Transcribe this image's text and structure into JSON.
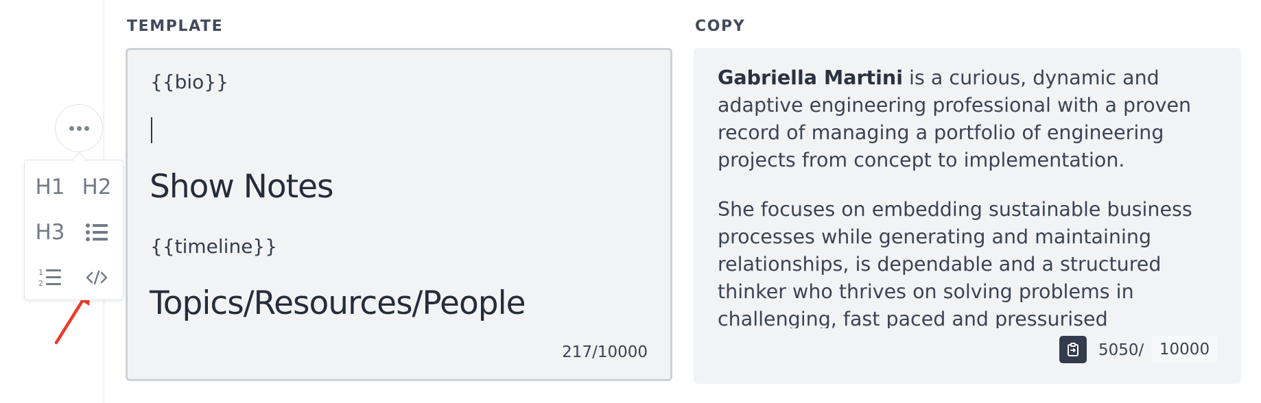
{
  "sections": {
    "template_label": "TEMPLATE",
    "copy_label": "COPY"
  },
  "template": {
    "line1": "{{bio}}",
    "heading1": "Show Notes",
    "line2": "{{timeline}}",
    "heading2": "Topics/Resources/People",
    "char_count": "217/10000"
  },
  "copy": {
    "name": "Gabriella Martini",
    "para1_rest": " is a curious, dynamic and adaptive engineering professional with a proven record of managing a portfolio of engineering projects from concept to implementation.",
    "para2": "She focuses on embedding sustainable business processes while generating and maintaining relationships, is dependable and a structured thinker who thrives on solving problems in challenging, fast paced and pressurised environments.",
    "char_count": "5050/",
    "limit": "10000",
    "copy_icon": "clipboard-icon"
  },
  "format_menu": {
    "more_icon": "more-horizontal-icon",
    "h1": "H1",
    "h2": "H2",
    "h3": "H3",
    "bullet_icon": "bulleted-list-icon",
    "numbered_icon": "numbered-list-icon",
    "code_icon": "code-icon"
  },
  "annotation": {
    "arrow_color": "#ee3b2a",
    "arrow_icon": "red-arrow-icon"
  }
}
